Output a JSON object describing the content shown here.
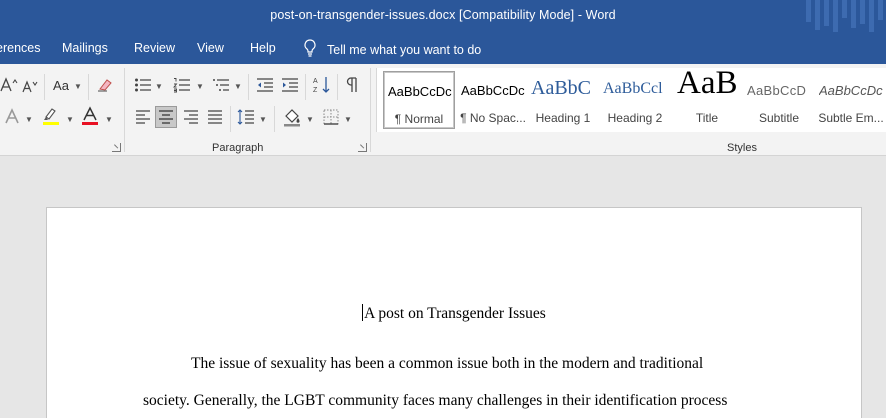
{
  "window": {
    "title": "post-on-transgender-issues.docx [Compatibility Mode]  -  Word"
  },
  "ribbon_tabs": [
    {
      "label": "erences"
    },
    {
      "label": "Mailings"
    },
    {
      "label": "Review"
    },
    {
      "label": "View"
    },
    {
      "label": "Help"
    }
  ],
  "tell_me": {
    "label": "Tell me what you want to do"
  },
  "font_group": {
    "change_case_label": "Aa"
  },
  "groups": {
    "paragraph": "Paragraph",
    "styles": "Styles"
  },
  "styles_gallery": [
    {
      "sample": "AaBbCcDc",
      "name": "¶ Normal",
      "selected": true
    },
    {
      "sample": "AaBbCcDc",
      "name": "¶ No Spac..."
    },
    {
      "sample": "AaBbC",
      "name": "Heading 1"
    },
    {
      "sample": "AaBbCcl",
      "name": "Heading 2"
    },
    {
      "sample": "AaB",
      "name": "Title"
    },
    {
      "sample": "AaBbCcD",
      "name": "Subtitle"
    },
    {
      "sample": "AaBbCcDc",
      "name": "Subtle Em..."
    }
  ],
  "document": {
    "title": "A post on Transgender Issues",
    "lines": [
      "The issue of sexuality has been a common issue both in the modern and traditional",
      "society. Generally, the LGBT community faces many challenges in their identification process"
    ]
  },
  "colors": {
    "word_blue": "#2b579a",
    "highlight_yellow": "#ffff00",
    "font_color_red": "#e81123"
  }
}
